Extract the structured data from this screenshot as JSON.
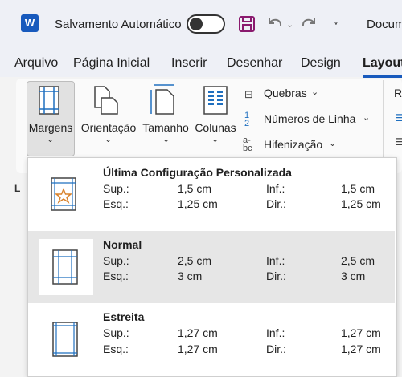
{
  "titlebar": {
    "app_logo": "W",
    "autosave_label": "Salvamento Automático",
    "doc_title": "Docum"
  },
  "tabs": [
    "Arquivo",
    "Página Inicial",
    "Inserir",
    "Desenhar",
    "Design",
    "Layout"
  ],
  "ribbon": {
    "margens": "Margens",
    "orientacao": "Orientação",
    "tamanho": "Tamanho",
    "colunas": "Colunas",
    "quebras": "Quebras",
    "numeros_linha": "Números de Linha",
    "hifenizacao": "Hifenização",
    "cut_letter": "R"
  },
  "margins_menu": [
    {
      "title": "Última Configuração Personalizada",
      "sup_label": "Sup.:",
      "sup": "1,5 cm",
      "inf_label": "Inf.:",
      "inf": "1,5 cm",
      "esq_label": "Esq.:",
      "esq": "1,25 cm",
      "dir_label": "Dir.:",
      "dir": "1,25 cm"
    },
    {
      "title": "Normal",
      "sup_label": "Sup.:",
      "sup": "2,5 cm",
      "inf_label": "Inf.:",
      "inf": "2,5 cm",
      "esq_label": "Esq.:",
      "esq": "3 cm",
      "dir_label": "Dir.:",
      "dir": "3 cm"
    },
    {
      "title": "Estreita",
      "sup_label": "Sup.:",
      "sup": "1,27 cm",
      "inf_label": "Inf.:",
      "inf": "1,27 cm",
      "esq_label": "Esq.:",
      "esq": "1,27 cm",
      "dir_label": "Dir.:",
      "dir": "1,27 cm"
    }
  ]
}
